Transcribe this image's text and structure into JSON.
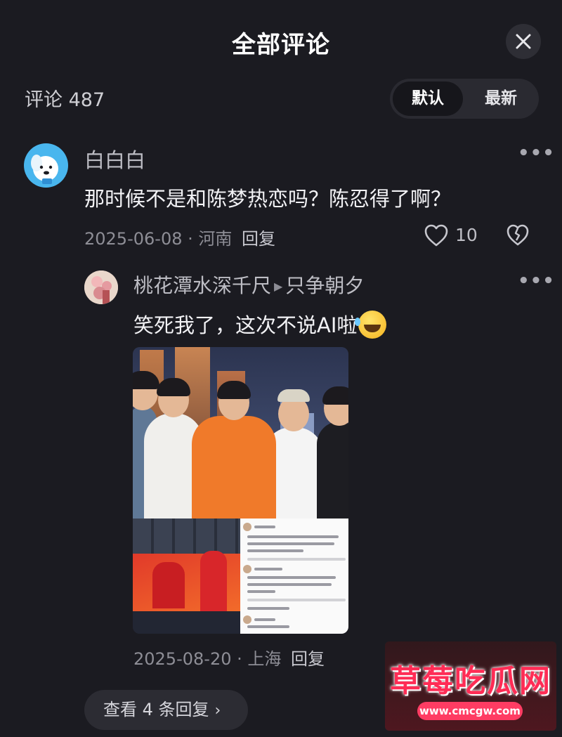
{
  "header": {
    "title": "全部评论"
  },
  "comments_bar": {
    "count_label": "评论 487",
    "sort": [
      "默认",
      "最新"
    ],
    "selected_sort": "默认"
  },
  "comment": {
    "username": "白白白",
    "text": "那时候不是和陈梦热恋吗？陈忍得了啊？",
    "date": "2025-06-08",
    "location": "河南",
    "reply_label": "回复",
    "likes": "10"
  },
  "reply": {
    "username": "桃花潭水深千尺",
    "reply_to": "只争朝夕",
    "text": "笑死我了，这次不说AI啦",
    "emoji": "rolling-on-floor-laughing-emoji",
    "date": "2025-08-20",
    "location": "上海",
    "reply_label": "回复"
  },
  "view_replies": {
    "label": "查看 4 条回复"
  },
  "watermark": {
    "title": "草莓吃瓜网",
    "url": "www.cmcgw.com"
  },
  "colors": {
    "background": "#1b1b21",
    "text_primary": "#f2f2f5",
    "text_secondary": "#8e8e96",
    "watermark": "#ff2c55"
  }
}
